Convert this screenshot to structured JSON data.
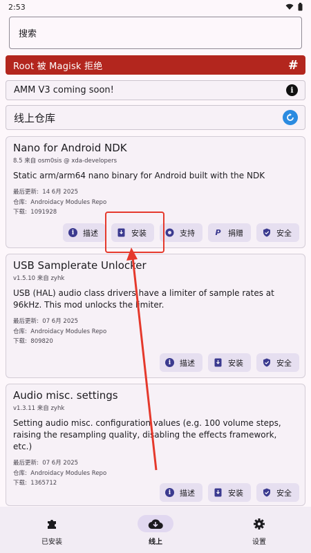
{
  "status": {
    "time": "2:53"
  },
  "search": {
    "placeholder": "搜索"
  },
  "banners": {
    "root_denied": "Root 被 Magisk 拒绝",
    "amm": "AMM V3 coming soon!",
    "repo": "线上仓库"
  },
  "labels": {
    "last_updated": "最后更新:",
    "repo": "仓库:",
    "downloads": "下载:"
  },
  "modules": [
    {
      "title": "Nano for Android NDK",
      "subtitle": "8.5 来自 osm0sis @ xda-developers",
      "description": "Static arm/arm64 nano binary for Android built with the NDK",
      "updated": "14 6月 2025",
      "repo": "Androidacy Modules Repo",
      "downloads": "1091928",
      "actions": [
        "描述",
        "安装",
        "支持",
        "捐赠",
        "安全"
      ]
    },
    {
      "title": "USB Samplerate Unlocker",
      "subtitle": "v1.5.10 来自 zyhk",
      "description": "USB (HAL) audio class drivers have a limiter of sample rates at 96kHz. This mod unlocks the limiter.",
      "updated": "07 6月 2025",
      "repo": "Androidacy Modules Repo",
      "downloads": "809820",
      "actions": [
        "描述",
        "安装",
        "安全"
      ]
    },
    {
      "title": "Audio misc. settings",
      "subtitle": "v1.3.11 来自 zyhk",
      "description": "Setting audio misc. configuration values (e.g. 100 volume steps, raising the resampling quality, disabling the effects framework, etc.)",
      "updated": "07 6月 2025",
      "repo": "Androidacy Modules Repo",
      "downloads": "1365712",
      "actions": [
        "描述",
        "安装",
        "安全"
      ]
    }
  ],
  "nav": {
    "installed": "已安装",
    "online": "线上",
    "settings": "设置"
  },
  "colors": {
    "root_banner": "#b3261e",
    "chip_bg": "#e6dff0",
    "annotation": "#e5392c"
  }
}
